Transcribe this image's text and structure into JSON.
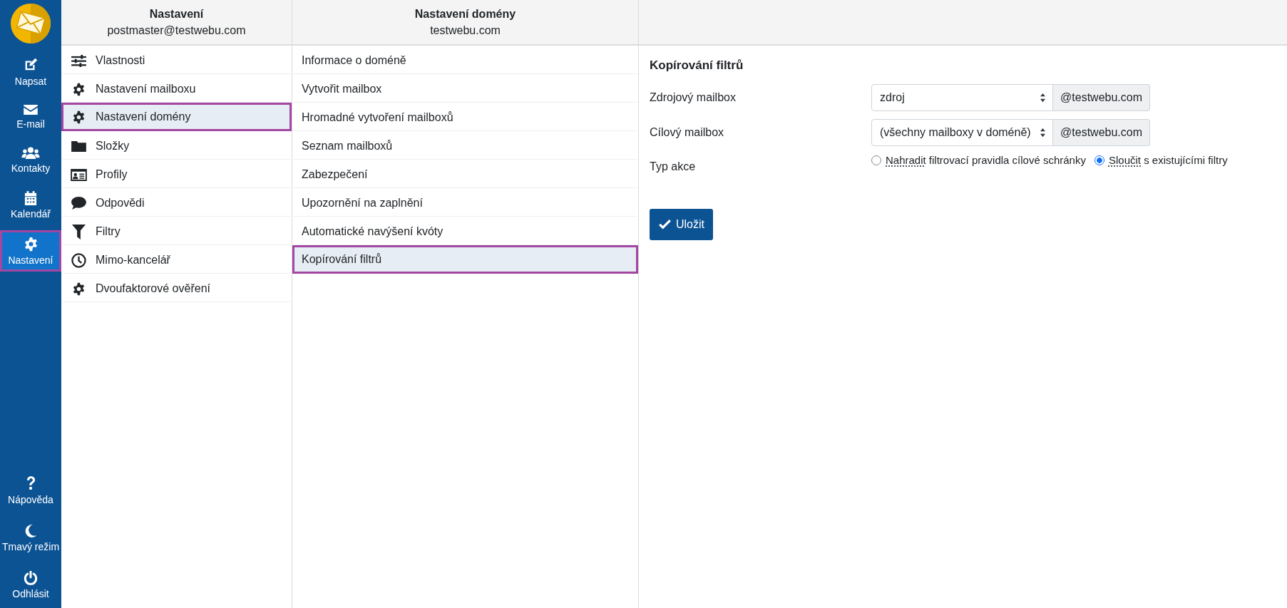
{
  "nav": {
    "items": [
      {
        "label": "Napsat",
        "selected": false
      },
      {
        "label": "E-mail",
        "selected": false
      },
      {
        "label": "Kontakty",
        "selected": false
      },
      {
        "label": "Kalendář",
        "selected": false
      },
      {
        "label": "Nastavení",
        "selected": true
      }
    ],
    "bottom_items": [
      {
        "label": "Nápověda"
      },
      {
        "label": "Tmavý režim"
      },
      {
        "label": "Odhlásit"
      }
    ]
  },
  "settings_menu": {
    "title": "Nastavení",
    "subtitle": "postmaster@testwebu.com",
    "items": [
      {
        "label": "Vlastnosti",
        "selected": false
      },
      {
        "label": "Nastavení mailboxu",
        "selected": false
      },
      {
        "label": "Nastavení domény",
        "selected": true
      },
      {
        "label": "Složky",
        "selected": false
      },
      {
        "label": "Profily",
        "selected": false
      },
      {
        "label": "Odpovědi",
        "selected": false
      },
      {
        "label": "Filtry",
        "selected": false
      },
      {
        "label": "Mimo-kancelář",
        "selected": false
      },
      {
        "label": "Dvoufaktorové ověření",
        "selected": false
      }
    ]
  },
  "domain_menu": {
    "title": "Nastavení domény",
    "subtitle": "testwebu.com",
    "items": [
      {
        "label": "Informace o doméně",
        "selected": false
      },
      {
        "label": "Vytvořit mailbox",
        "selected": false
      },
      {
        "label": "Hromadné vytvoření mailboxů",
        "selected": false
      },
      {
        "label": "Seznam mailboxů",
        "selected": false
      },
      {
        "label": "Zabezpečení",
        "selected": false
      },
      {
        "label": "Upozornění na zaplnění",
        "selected": false
      },
      {
        "label": "Automatické navýšení kvóty",
        "selected": false
      },
      {
        "label": "Kopírování filtrů",
        "selected": true
      }
    ]
  },
  "form": {
    "title": "Kopírování filtrů",
    "fields": [
      {
        "label": "Zdrojový mailbox",
        "value": "zdroj",
        "suffix": "@testwebu.com"
      },
      {
        "label": "Cílový mailbox",
        "value": "(všechny mailboxy v doméně)",
        "suffix": "@testwebu.com"
      }
    ],
    "action": {
      "label": "Typ akce",
      "options": [
        {
          "abbr": "Nahradit",
          "rest": " filtrovací pravidla cílové schránky",
          "selected": false
        },
        {
          "abbr": "Sloučit",
          "rest": " s existujícími filtry",
          "selected": true
        }
      ]
    },
    "save_button": "Uložit"
  }
}
